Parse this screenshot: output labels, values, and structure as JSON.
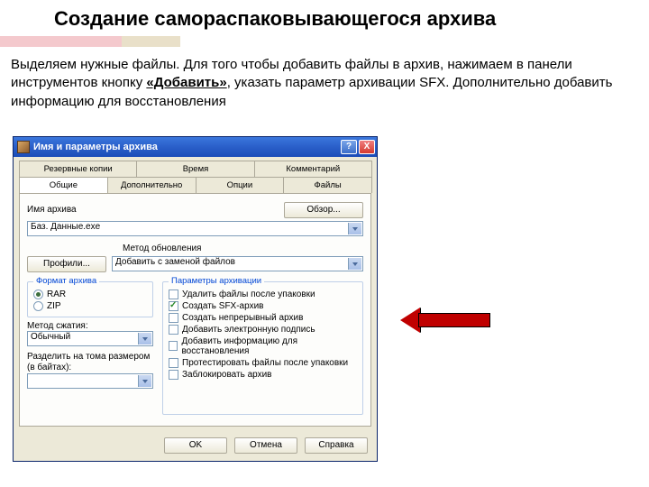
{
  "slide": {
    "title": "Создание самораспаковывающегося архива",
    "text_before": "Выделяем нужные файлы. Для того чтобы добавить файлы в архив, нажимаем в панели инструментов кнопку ",
    "text_bold": "«Добавить»",
    "text_after": ", указать параметр архивации SFX. Дополнительно добавить информацию для восстановления"
  },
  "dialog": {
    "title": "Имя и параметры архива",
    "help_btn": "?",
    "close_btn": "X",
    "tabs_row1": [
      "Резервные копии",
      "Время",
      "Комментарий"
    ],
    "tabs_row2": [
      "Общие",
      "Дополнительно",
      "Опции",
      "Файлы"
    ],
    "active_tab": "Общие",
    "name_label": "Имя архива",
    "name_value": "Баз. Данные.exe",
    "browse_btn": "Обзор...",
    "method_label": "Метод обновления",
    "method_value": "Добавить с заменой файлов",
    "profiles_btn": "Профили...",
    "format_group": "Формат архива",
    "format_rar": "RAR",
    "format_zip": "ZIP",
    "comp_label": "Метод сжатия:",
    "comp_value": "Обычный",
    "split_label": "Разделить на тома размером (в байтах):",
    "split_value": "",
    "params_group": "Параметры архивации",
    "params": [
      {
        "label": "Удалить файлы после упаковки",
        "checked": false
      },
      {
        "label": "Создать SFX-архив",
        "checked": true
      },
      {
        "label": "Создать непрерывный архив",
        "checked": false
      },
      {
        "label": "Добавить электронную подпись",
        "checked": false
      },
      {
        "label": "Добавить информацию для восстановления",
        "checked": false
      },
      {
        "label": "Протестировать файлы после упаковки",
        "checked": false
      },
      {
        "label": "Заблокировать архив",
        "checked": false
      }
    ],
    "ok_btn": "OK",
    "cancel_btn": "Отмена",
    "help_bottom_btn": "Справка"
  }
}
